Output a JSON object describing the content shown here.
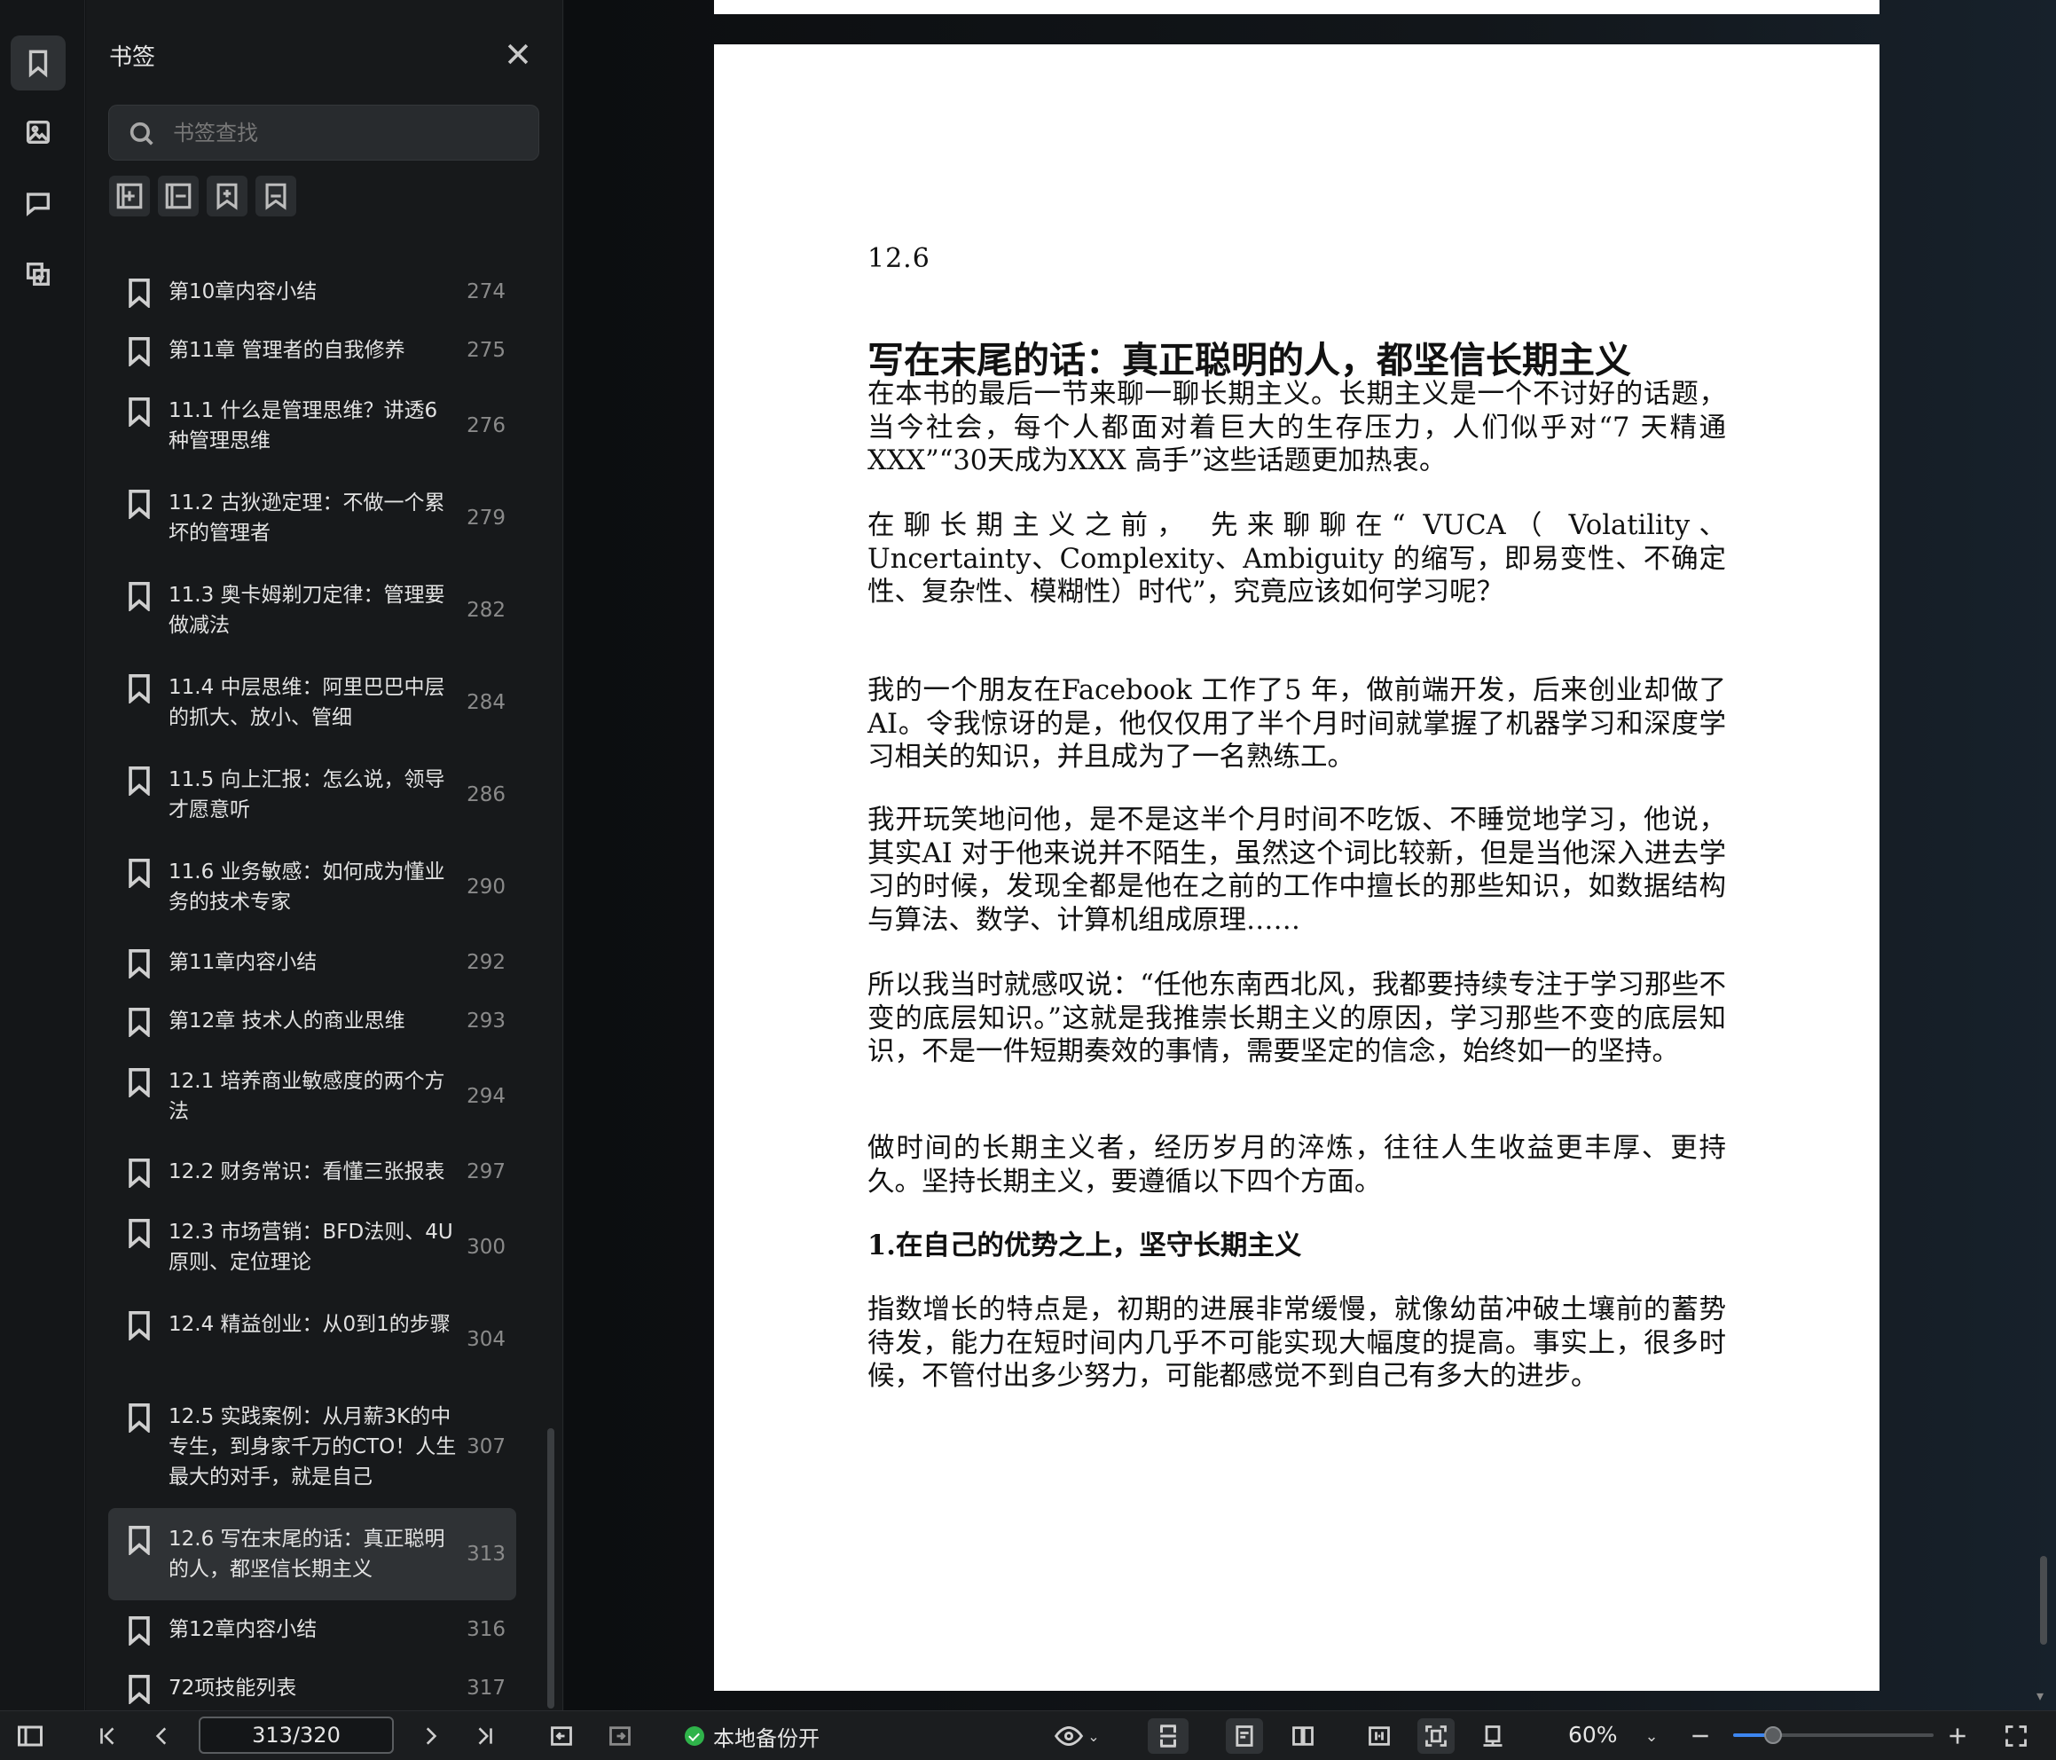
{
  "sidebar_rail": {
    "items": [
      {
        "name": "bookmark",
        "icon": "bookmark-icon",
        "active": true
      },
      {
        "name": "thumbnail",
        "icon": "image-icon",
        "active": false
      },
      {
        "name": "comment",
        "icon": "comment-icon",
        "active": false
      },
      {
        "name": "extract",
        "icon": "extract-icon",
        "active": false
      }
    ]
  },
  "bookmark_panel": {
    "title": "书签",
    "search_placeholder": "书签查找",
    "tools": [
      "add-bookmark-icon",
      "remove-bookmark-icon",
      "add-sub-bookmark-icon",
      "bookmark-outline-icon"
    ],
    "items": [
      {
        "label": "第10章内容小结",
        "page": "274"
      },
      {
        "label": "第11章 管理者的自我修养",
        "page": "275"
      },
      {
        "label": "11.1 什么是管理思维？讲透6种管理思维",
        "page": "276"
      },
      {
        "label": "11.2 古狄逊定理：不做一个累坏的管理者",
        "page": "279"
      },
      {
        "label": "11.3 奥卡姆剃刀定律：管理要做减法",
        "page": "282"
      },
      {
        "label": "11.4 中层思维：阿里巴巴中层的抓大、放小、管细",
        "page": "284"
      },
      {
        "label": "11.5 向上汇报：怎么说，领导才愿意听",
        "page": "286"
      },
      {
        "label": "11.6 业务敏感：如何成为懂业务的技术专家",
        "page": "290"
      },
      {
        "label": "第11章内容小结",
        "page": "292"
      },
      {
        "label": "第12章 技术人的商业思维",
        "page": "293"
      },
      {
        "label": "12.1 培养商业敏感度的两个方法",
        "page": "294"
      },
      {
        "label": "12.2 财务常识：看懂三张报表",
        "page": "297"
      },
      {
        "label": "12.3 市场营销：BFD法则、4U原则、定位理论",
        "page": "300"
      },
      {
        "label": "12.4 精益创业：从0到1的步骤",
        "page": "304"
      },
      {
        "label": "12.5 实践案例：从月薪3K的中专生，到身家千万的CTO！人生最大的对手，就是自己",
        "page": "307"
      },
      {
        "label": "12.6 写在末尾的话：真正聪明的人，都坚信长期主义",
        "page": "313",
        "active": true
      },
      {
        "label": "第12章内容小结",
        "page": "316"
      },
      {
        "label": "72项技能列表",
        "page": "317"
      }
    ]
  },
  "document": {
    "section_number": "12.6",
    "title": "写在末尾的话：真正聪明的人，都坚信长期主义",
    "paragraphs": [
      {
        "text": "在本书的最后一节来聊一聊长期主义。长期主义是一个不讨好的话题，当今社会，每个人都面对着巨大的生存压力，人们似乎对“7  天精通XXX”“30天成为XXX  高手”这些话题更加热衷。",
        "bold": false
      },
      {
        "text": "在聊长期主义之前，  先来聊聊在“  VUCA（  Volatility、  Uncertainty、Complexity、Ambiguity  的缩写，即易变性、不确定性、复杂性、模糊性）时代”，究竟应该如何学习呢？",
        "bold": false
      },
      {
        "text": "我的一个朋友在Facebook  工作了5  年，做前端开发，后来创业却做了AI。令我惊讶的是，他仅仅用了半个月时间就掌握了机器学习和深度学习相关的知识，并且成为了一名熟练工。",
        "bold": false
      },
      {
        "text": "我开玩笑地问他，是不是这半个月时间不吃饭、不睡觉地学习，他说，其实AI  对于他来说并不陌生，虽然这个词比较新，但是当他深入进去学习的时候，发现全都是他在之前的工作中擅长的那些知识，如数据结构与算法、数学、计算机组成原理……",
        "bold": false
      },
      {
        "text": "所以我当时就感叹说：“任他东南西北风，我都要持续专注于学习那些不变的底层知识。”这就是我推崇长期主义的原因，学习那些不变的底层知识，不是一件短期奏效的事情，需要坚定的信念，始终如一的坚持。",
        "bold": false
      },
      {
        "text": "做时间的长期主义者，经历岁月的淬炼，往往人生收益更丰厚、更持久。坚持长期主义，要遵循以下四个方面。",
        "bold": false
      },
      {
        "text": "1.在自己的优势之上，坚守长期主义",
        "bold": true
      },
      {
        "text": "指数增长的特点是，初期的进展非常缓慢，就像幼苗冲破土壤前的蓄势待发，能力在短时间内几乎不可能实现大幅度的提高。事实上，很多时候，不管付出多少努力，可能都感觉不到自己有多大的进步。",
        "bold": false
      }
    ]
  },
  "toolbar": {
    "page_indicator": "313/320",
    "backup_label": "本地备份开",
    "zoom_label": "60%",
    "zoom_fraction": 0.2,
    "accent_color": "#3d86f0",
    "backup_status_color": "#2fb34a"
  }
}
